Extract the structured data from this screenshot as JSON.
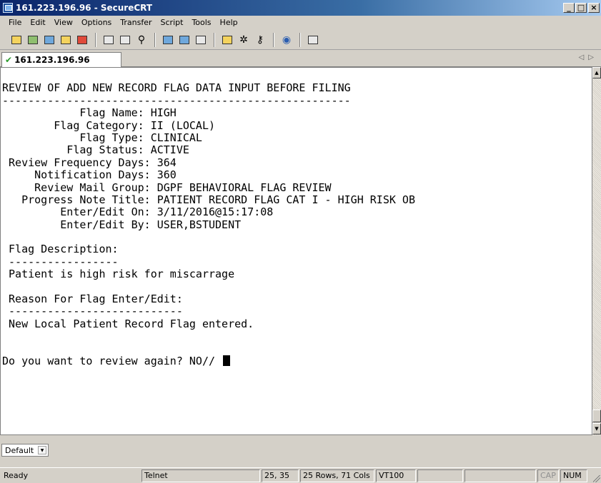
{
  "window": {
    "title": "161.223.196.96 - SecureCRT",
    "min_glyph": "_",
    "max_glyph": "□",
    "close_glyph": "×"
  },
  "menu": [
    "File",
    "Edit",
    "View",
    "Options",
    "Transfer",
    "Script",
    "Tools",
    "Help"
  ],
  "toolbar": {
    "icons": [
      "connect-icon",
      "quick-connect-icon",
      "connect-in-tab-icon",
      "reconnect-icon",
      "disconnect-icon",
      "copy-icon",
      "paste-icon",
      "find-icon",
      "print-icon",
      "print-selection-icon",
      "print-setup-icon",
      "session-options-icon",
      "global-options-icon",
      "keymap-icon",
      "help-icon",
      "sftp-icon"
    ]
  },
  "tab": {
    "label": "161.223.196.96",
    "check_glyph": "✔",
    "arrows": "◁▷"
  },
  "terminal": {
    "lines": [
      "",
      "REVIEW OF ADD NEW RECORD FLAG DATA INPUT BEFORE FILING",
      "------------------------------------------------------",
      "            Flag Name: HIGH",
      "        Flag Category: II (LOCAL)",
      "            Flag Type: CLINICAL",
      "          Flag Status: ACTIVE",
      " Review Frequency Days: 364",
      "     Notification Days: 360",
      "     Review Mail Group: DGPF BEHAVIORAL FLAG REVIEW",
      "   Progress Note Title: PATIENT RECORD FLAG CAT I - HIGH RISK OB",
      "         Enter/Edit On: 3/11/2016@15:17:08",
      "         Enter/Edit By: USER,BSTUDENT",
      "",
      " Flag Description:",
      " -----------------",
      " Patient is high risk for miscarrage",
      "",
      " Reason For Flag Enter/Edit:",
      " ---------------------------",
      " New Local Patient Record Flag entered.",
      "",
      "",
      "Do you want to review again? NO// "
    ],
    "cursor_line": 23
  },
  "session_bar": {
    "selected": "Default"
  },
  "status_bar": {
    "state": "Ready",
    "protocol": "Telnet",
    "cursor_pos": "25, 35",
    "size": "25 Rows, 71 Cols",
    "emulation": "VT100",
    "caps": "CAP",
    "num": "NUM"
  }
}
